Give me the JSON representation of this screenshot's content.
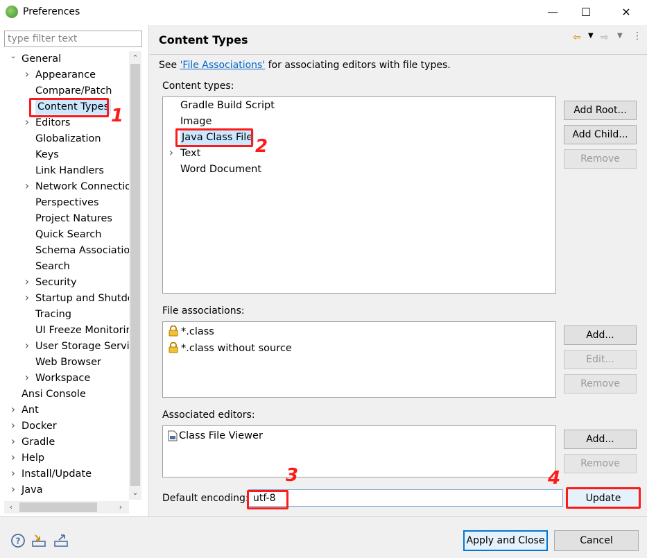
{
  "window": {
    "title": "Preferences",
    "minimize": "—",
    "maximize": "☐",
    "close": "✕"
  },
  "filter": {
    "placeholder": "type filter text"
  },
  "tree": [
    {
      "label": "General",
      "indent": 0,
      "arrow": "down"
    },
    {
      "label": "Appearance",
      "indent": 1,
      "arrow": "right"
    },
    {
      "label": "Compare/Patch",
      "indent": 1,
      "arrow": ""
    },
    {
      "label": "Content Types",
      "indent": 1,
      "arrow": "",
      "selected": true
    },
    {
      "label": "Editors",
      "indent": 1,
      "arrow": "right"
    },
    {
      "label": "Globalization",
      "indent": 1,
      "arrow": ""
    },
    {
      "label": "Keys",
      "indent": 1,
      "arrow": ""
    },
    {
      "label": "Link Handlers",
      "indent": 1,
      "arrow": ""
    },
    {
      "label": "Network Connectio",
      "indent": 1,
      "arrow": "right"
    },
    {
      "label": "Perspectives",
      "indent": 1,
      "arrow": ""
    },
    {
      "label": "Project Natures",
      "indent": 1,
      "arrow": ""
    },
    {
      "label": "Quick Search",
      "indent": 1,
      "arrow": ""
    },
    {
      "label": "Schema Association",
      "indent": 1,
      "arrow": ""
    },
    {
      "label": "Search",
      "indent": 1,
      "arrow": ""
    },
    {
      "label": "Security",
      "indent": 1,
      "arrow": "right"
    },
    {
      "label": "Startup and Shutdo",
      "indent": 1,
      "arrow": "right"
    },
    {
      "label": "Tracing",
      "indent": 1,
      "arrow": ""
    },
    {
      "label": "UI Freeze Monitorin",
      "indent": 1,
      "arrow": ""
    },
    {
      "label": "User Storage Servic",
      "indent": 1,
      "arrow": "right"
    },
    {
      "label": "Web Browser",
      "indent": 1,
      "arrow": ""
    },
    {
      "label": "Workspace",
      "indent": 1,
      "arrow": "right"
    },
    {
      "label": "Ansi Console",
      "indent": 0,
      "arrow": ""
    },
    {
      "label": "Ant",
      "indent": 0,
      "arrow": "right"
    },
    {
      "label": "Docker",
      "indent": 0,
      "arrow": "right"
    },
    {
      "label": "Gradle",
      "indent": 0,
      "arrow": "right"
    },
    {
      "label": "Help",
      "indent": 0,
      "arrow": "right"
    },
    {
      "label": "Install/Update",
      "indent": 0,
      "arrow": "right"
    },
    {
      "label": "Java",
      "indent": 0,
      "arrow": "right"
    }
  ],
  "page": {
    "title": "Content Types",
    "see_prefix": "See ",
    "see_link": "'File Associations'",
    "see_suffix": " for associating editors with file types.",
    "content_types_label": "Content types:",
    "content_types": [
      {
        "label": "Gradle Build Script",
        "arrow": ""
      },
      {
        "label": "Image",
        "arrow": ""
      },
      {
        "label": "Java Class File",
        "arrow": "",
        "selected": true
      },
      {
        "label": "Text",
        "arrow": "right"
      },
      {
        "label": "Word Document",
        "arrow": ""
      }
    ],
    "add_root": "Add Root...",
    "add_child": "Add Child...",
    "remove": "Remove",
    "file_assoc_label": "File associations:",
    "file_associations": [
      "*.class",
      "*.class without source"
    ],
    "add": "Add...",
    "edit": "Edit...",
    "assoc_editors_label": "Associated editors:",
    "associated_editors": [
      "Class File Viewer"
    ],
    "default_encoding_label": "Default encoding:",
    "default_encoding_value": "utf-8",
    "update": "Update"
  },
  "footer": {
    "apply_close": "Apply and Close",
    "cancel": "Cancel"
  },
  "annotations": [
    "1",
    "2",
    "3",
    "4"
  ],
  "colors": {
    "annotation": "#ff1a1a",
    "link": "#0066cc",
    "selection": "#cce8ff"
  }
}
